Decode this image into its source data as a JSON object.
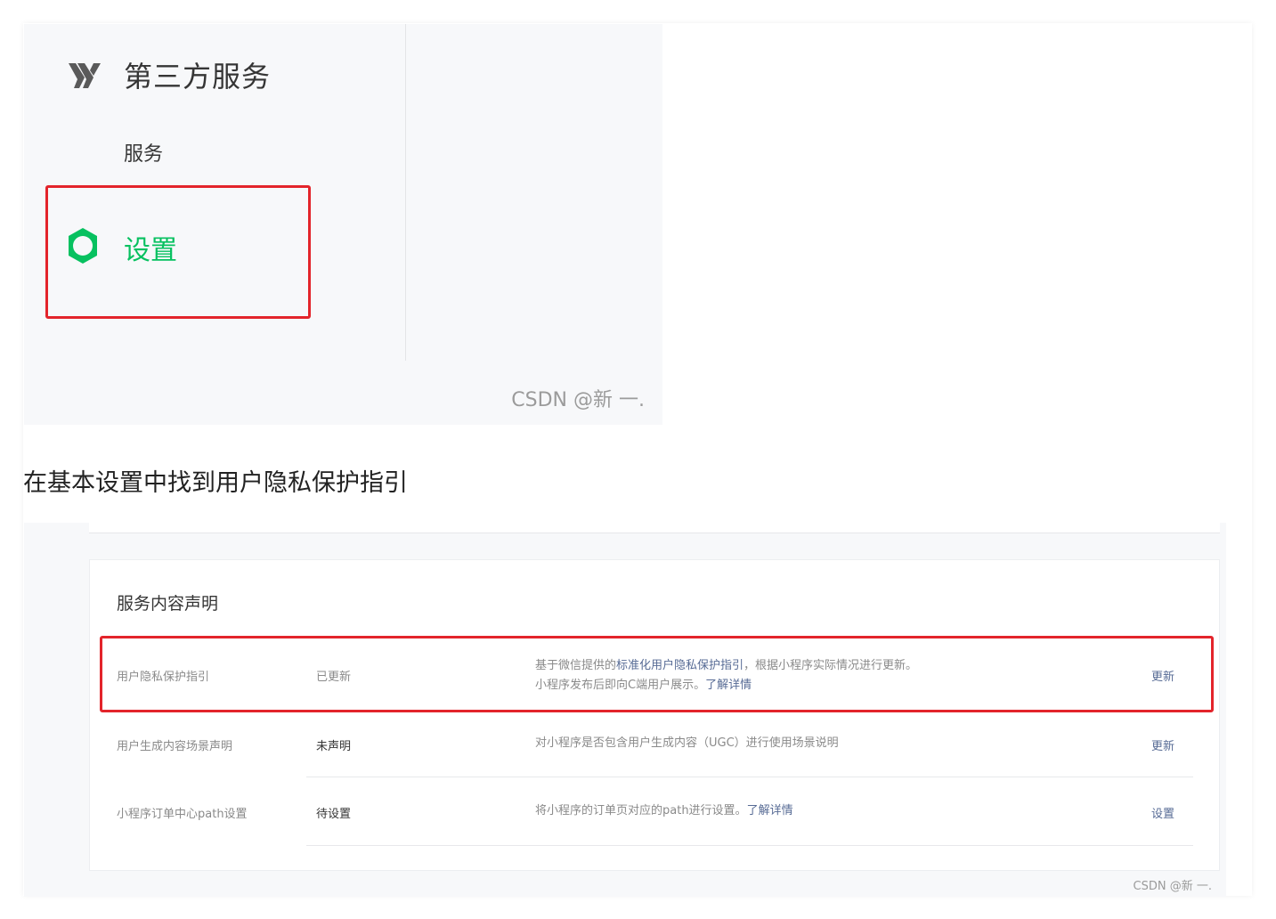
{
  "top_panel": {
    "brand_title": "第三方服务",
    "nav_services": "服务",
    "nav_settings": "设置",
    "watermark": "CSDN @新 一.",
    "icons": {
      "brand": "brand-logo-icon",
      "settings": "gear-icon"
    },
    "colors": {
      "accent_green": "#07c160",
      "highlight_red": "#e3242b"
    }
  },
  "caption": "在基本设置中找到用户隐私保护指引",
  "bottom_panel": {
    "card_title": "服务内容声明",
    "rows": [
      {
        "name": "用户隐私保护指引",
        "status": "已更新",
        "desc_prefix": "基于微信提供的",
        "desc_link": "标准化用户隐私保护指引",
        "desc_suffix": "，根据小程序实际情况进行更新。",
        "desc_line2": "小程序发布后即向C端用户展示。",
        "desc_line2_link": "了解详情",
        "action": "更新"
      },
      {
        "name": "用户生成内容场景声明",
        "status": "未声明",
        "desc": "对小程序是否包含用户生成内容（UGC）进行使用场景说明",
        "action": "更新"
      },
      {
        "name": "小程序订单中心path设置",
        "status": "待设置",
        "desc": "将小程序的订单页对应的path进行设置。",
        "desc_link": "了解详情",
        "action": "设置"
      }
    ],
    "watermark": "CSDN @新 一."
  }
}
